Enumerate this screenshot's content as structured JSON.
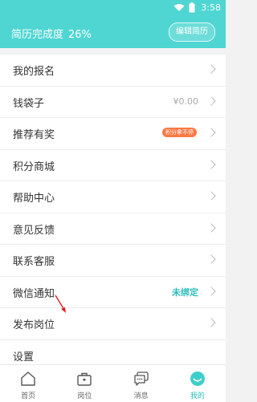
{
  "status": {
    "time": "3:58"
  },
  "header": {
    "resume_label": "简历完成度",
    "resume_percent": "26%",
    "edit_button": "编辑简历"
  },
  "menu": {
    "items": [
      {
        "label": "我的报名"
      },
      {
        "label": "钱袋子",
        "value": "¥0.00"
      },
      {
        "label": "推荐有奖",
        "badge": "积分拿不停"
      },
      {
        "label": "积分商城"
      },
      {
        "label": "帮助中心"
      },
      {
        "label": "意见反馈"
      },
      {
        "label": "联系客服"
      },
      {
        "label": "微信通知",
        "value": "未绑定"
      },
      {
        "label": "发布岗位"
      },
      {
        "label": "设置"
      }
    ]
  },
  "tabbar": {
    "tabs": [
      {
        "label": "首页",
        "icon": "home-icon"
      },
      {
        "label": "岗位",
        "icon": "briefcase-icon"
      },
      {
        "label": "消息",
        "icon": "message-icon"
      },
      {
        "label": "我的",
        "icon": "profile-icon"
      }
    ],
    "active": "我的"
  },
  "colors": {
    "accent": "#4fd6d2",
    "accent_text": "#2cbdbb",
    "badge": "#ff7a45",
    "annotation_arrow": "#e02020"
  }
}
